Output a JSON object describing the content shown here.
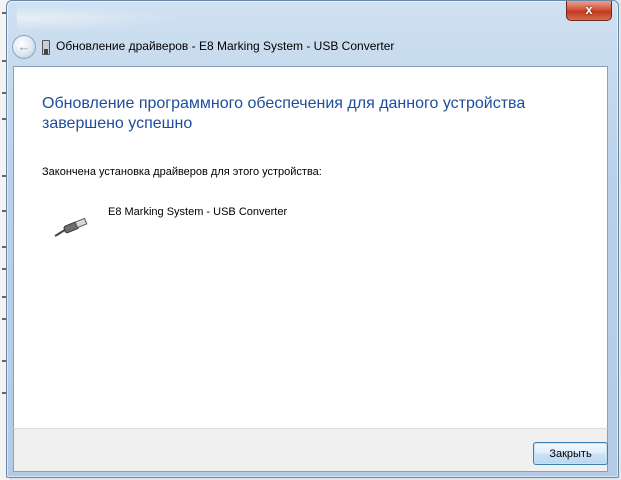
{
  "window": {
    "title": "Обновление драйверов - E8 Marking System - USB Converter",
    "close_glyph": "x"
  },
  "nav": {
    "back_glyph": "←"
  },
  "content": {
    "heading": "Обновление программного обеспечения для данного устройства завершено успешно",
    "subtext": "Закончена установка драйверов для этого устройства:",
    "device_name": "E8 Marking System - USB Converter"
  },
  "footer": {
    "close_button_label": "Закрыть"
  },
  "icons": {
    "window_icon": "usb-connector-icon",
    "device_icon": "usb-cable-icon"
  },
  "colors": {
    "heading": "#1d4d9c",
    "button_border": "#3c7fb1",
    "close_red": "#c03a1d"
  }
}
